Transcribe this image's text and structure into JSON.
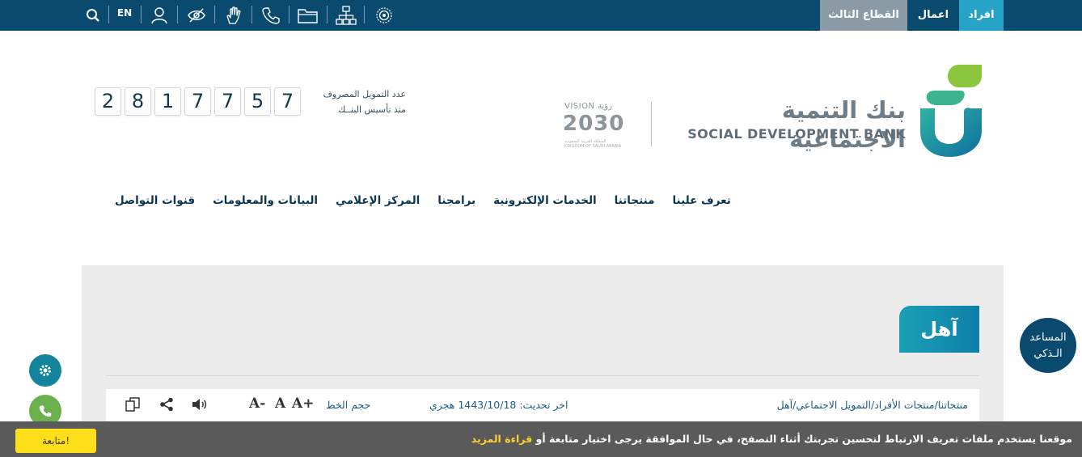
{
  "topbar": {
    "tabs": {
      "third_sector": "القطاع الثالث",
      "business": "اعمال",
      "individuals": "افراد"
    },
    "language": "EN",
    "icons": [
      "search-icon",
      "user-icon",
      "eye-slash-icon",
      "sign-language-icon",
      "phone-icon",
      "folder-icon",
      "sitemap-icon",
      "gear-badge-icon"
    ]
  },
  "header": {
    "bank_name_ar": "بنك التنمية الاجتماعية",
    "bank_name_en": "SOCIAL DEVELOPMENT BANK",
    "vision": {
      "top": "VISION رؤية",
      "number": "2030",
      "sub": "المملكة العربية السعودية KINGDOM OF SAUDI ARABIA"
    },
    "counter": {
      "label_line1": "عدد التمويل المصروف",
      "label_line2": "منذ تأسيس البنــك",
      "digits": [
        "2",
        "8",
        "1",
        "7",
        "7",
        "5",
        "7"
      ]
    }
  },
  "nav": {
    "items": [
      "تعرف علينا",
      "منتجاتنا",
      "الخدمات الإلكترونية",
      "برامجنا",
      "المركز الإعلامي",
      "البيانات والمعلومات",
      "قنوات التواصل"
    ]
  },
  "page": {
    "title": "آهل",
    "breadcrumb": "منتجاتنا/منتجات الأفراد/التمويل الاجتماعي/آهل",
    "updated": "اخر تحديث: 1443/10/18 هجري",
    "font_size_label": "حجم الخط",
    "font_plus": "A+",
    "font_normal": "A",
    "font_minus": "A-"
  },
  "assistant": {
    "line1": "المساعد",
    "line2": "الـذكي"
  },
  "cookie": {
    "text": "موقعنا يستخدم ملفات تعريف الارتباط لتحسين تجربتك أثناء التصفح، في حال الموافقة يرجى اختيار متابعة أو ",
    "read_more": "قراءة المزيد",
    "button": "متابعة!"
  },
  "colors": {
    "primary": "#0b4a6f",
    "accent": "#26a3c6",
    "grey_tab": "#8a9aa6",
    "content_bg": "#ececec",
    "cookie_btn": "#ffde1a"
  }
}
